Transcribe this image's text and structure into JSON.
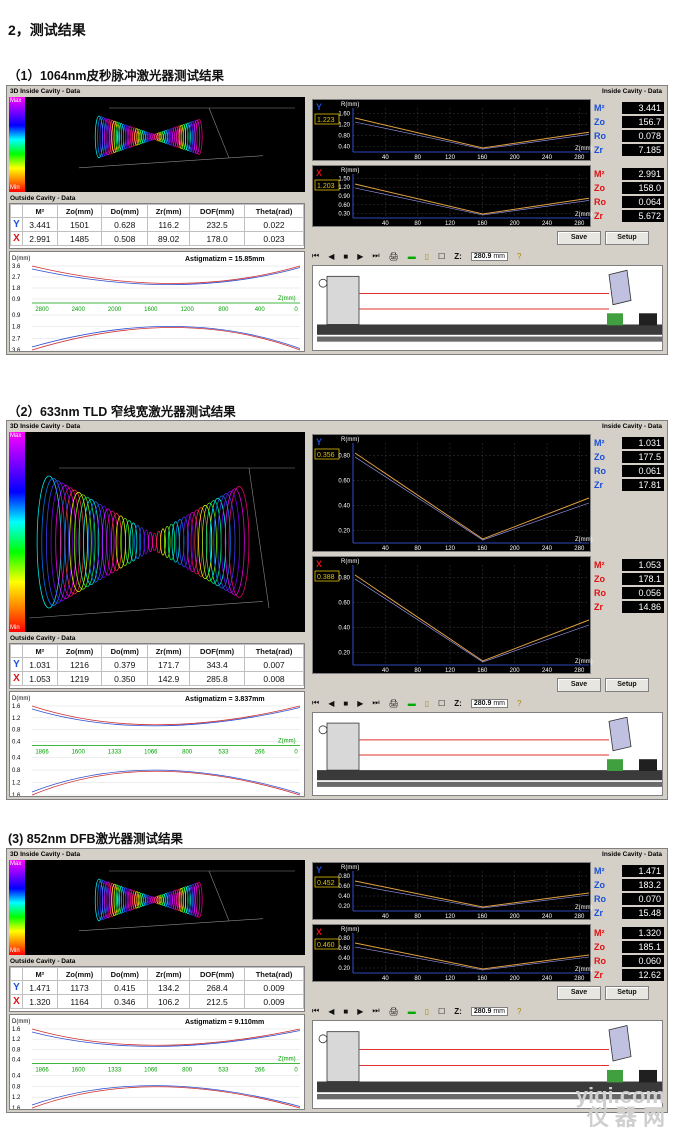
{
  "section_title": "2，测试结果",
  "common": {
    "inside_title": "3D Inside Cavity - Data",
    "outside_title": "Outside Cavity - Data",
    "right_title": "Inside Cavity - Data",
    "max_label": "Max",
    "min_label": "Min",
    "cols": [
      "",
      "M²",
      "Zo(mm)",
      "Do(mm)",
      "Zr(mm)",
      "DOF(mm)",
      "Theta(rad)"
    ],
    "y_label": "Y",
    "x_label": "X",
    "dmm": "D(mm)",
    "zmm": "Z(mm)",
    "rmm": "R(mm)",
    "save": "Save",
    "setup": "Setup",
    "z_label": "Z:",
    "z_value": "280.9",
    "z_unit": "mm",
    "param_labels": [
      "M²",
      "Zo",
      "Ro",
      "Zr"
    ]
  },
  "panels": [
    {
      "subtitle": "（1）1064nm皮秒脉冲激光器测试结果",
      "rows": [
        {
          "axis": "Y",
          "m2": "3.441",
          "zo": "1501",
          "do": "0.628",
          "zr": "116.2",
          "dof": "232.5",
          "theta": "0.022"
        },
        {
          "axis": "X",
          "m2": "2.991",
          "zo": "1485",
          "do": "0.508",
          "zr": "89.02",
          "dof": "178.0",
          "theta": "0.023"
        }
      ],
      "astig": "Astigmatizm = 15.85mm",
      "d_ticks_top": [
        "3.6",
        "2.7",
        "1.8",
        "0.9"
      ],
      "d_ticks_bot": [
        "0.9",
        "1.8",
        "2.7",
        "3.6"
      ],
      "z_ticks": [
        "2800",
        "2400",
        "2000",
        "1600",
        "1200",
        "800",
        "400",
        "0"
      ],
      "y_plot": {
        "box": "1.223",
        "ticks": [
          "1.60",
          "1.20",
          "0.80",
          "0.40"
        ],
        "x": [
          "40",
          "80",
          "120",
          "160",
          "200",
          "240",
          "280"
        ]
      },
      "x_plot": {
        "box": "1.203",
        "ticks": [
          "1.50",
          "1.20",
          "0.90",
          "0.60",
          "0.30"
        ],
        "x": [
          "40",
          "80",
          "120",
          "160",
          "200",
          "240",
          "280"
        ]
      },
      "y_params": [
        "3.441",
        "156.7",
        "0.078",
        "7.185"
      ],
      "x_params": [
        "2.991",
        "158.0",
        "0.064",
        "5.672"
      ]
    },
    {
      "subtitle": "（2）633nm TLD 窄线宽激光器测试结果",
      "rows": [
        {
          "axis": "Y",
          "m2": "1.031",
          "zo": "1216",
          "do": "0.379",
          "zr": "171.7",
          "dof": "343.4",
          "theta": "0.007"
        },
        {
          "axis": "X",
          "m2": "1.053",
          "zo": "1219",
          "do": "0.350",
          "zr": "142.9",
          "dof": "285.8",
          "theta": "0.008"
        }
      ],
      "astig": "Astigmatizm = 3.837mm",
      "d_ticks_top": [
        "1.6",
        "1.2",
        "0.8",
        "0.4"
      ],
      "d_ticks_bot": [
        "0.4",
        "0.8",
        "1.2",
        "1.6"
      ],
      "z_ticks": [
        "1866",
        "1600",
        "1333",
        "1066",
        "800",
        "533",
        "266",
        "0"
      ],
      "y_plot": {
        "box": "0.356",
        "ticks": [
          "0.80",
          "0.60",
          "0.40",
          "0.20"
        ],
        "x": [
          "40",
          "80",
          "120",
          "160",
          "200",
          "240",
          "280"
        ]
      },
      "x_plot": {
        "box": "0.388",
        "ticks": [
          "0.80",
          "0.60",
          "0.40",
          "0.20"
        ],
        "x": [
          "40",
          "80",
          "120",
          "160",
          "200",
          "240",
          "280"
        ]
      },
      "y_params": [
        "1.031",
        "177.5",
        "0.061",
        "17.81"
      ],
      "x_params": [
        "1.053",
        "178.1",
        "0.056",
        "14.86"
      ]
    },
    {
      "subtitle": "(3) 852nm DFB激光器测试结果",
      "rows": [
        {
          "axis": "Y",
          "m2": "1.471",
          "zo": "1173",
          "do": "0.415",
          "zr": "134.2",
          "dof": "268.4",
          "theta": "0.009"
        },
        {
          "axis": "X",
          "m2": "1.320",
          "zo": "1164",
          "do": "0.346",
          "zr": "106.2",
          "dof": "212.5",
          "theta": "0.009"
        }
      ],
      "astig": "Astigmatizm = 9.110mm",
      "d_ticks_top": [
        "1.6",
        "1.2",
        "0.8",
        "0.4"
      ],
      "d_ticks_bot": [
        "0.4",
        "0.8",
        "1.2",
        "1.6"
      ],
      "z_ticks": [
        "1866",
        "1600",
        "1333",
        "1066",
        "800",
        "533",
        "266",
        "0"
      ],
      "y_plot": {
        "box": "0.452",
        "ticks": [
          "0.80",
          "0.60",
          "0.40",
          "0.20"
        ],
        "x": [
          "40",
          "80",
          "120",
          "160",
          "200",
          "240",
          "280"
        ]
      },
      "x_plot": {
        "box": "0.460",
        "ticks": [
          "0.80",
          "0.60",
          "0.40",
          "0.20"
        ],
        "x": [
          "40",
          "80",
          "120",
          "160",
          "200",
          "240",
          "280"
        ]
      },
      "y_params": [
        "1.471",
        "183.2",
        "0.070",
        "15.48"
      ],
      "x_params": [
        "1.320",
        "185.1",
        "0.060",
        "12.62"
      ]
    }
  ],
  "watermark": {
    "line1": "yiqi.com",
    "line2": "仪 器 网"
  }
}
